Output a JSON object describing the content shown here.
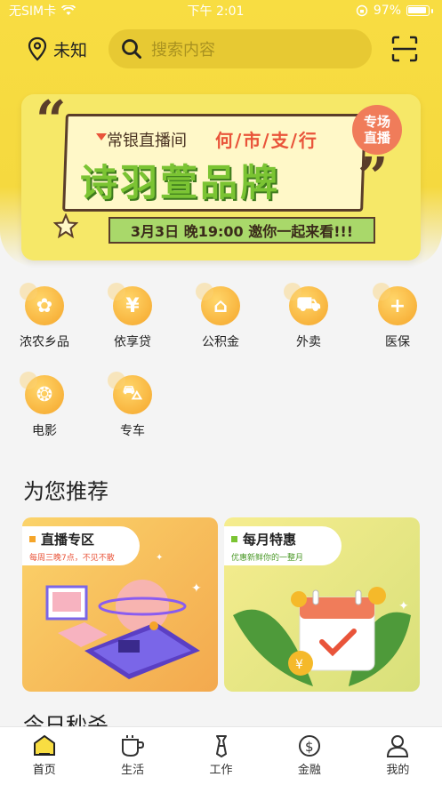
{
  "status_bar": {
    "carrier": "无SIM卡",
    "time": "下午 2:01",
    "battery": "97%"
  },
  "header": {
    "location": "未知",
    "search_placeholder": "搜索内容"
  },
  "banner": {
    "subtitle": "常银直播间",
    "tagline": "何/市/支/行",
    "title": "诗羽萱品牌",
    "bottom": "3月3日 晚19:00  邀你一起来看!!!",
    "badge": "专场直播"
  },
  "services": [
    {
      "label": "浓农乡品",
      "icon": "farm-icon"
    },
    {
      "label": "依享贷",
      "icon": "yen-icon"
    },
    {
      "label": "公积金",
      "icon": "house-icon"
    },
    {
      "label": "外卖",
      "icon": "scooter-icon"
    },
    {
      "label": "医保",
      "icon": "medical-cross-icon"
    },
    {
      "label": "电影",
      "icon": "film-reel-icon"
    },
    {
      "label": "专车",
      "icon": "car-icon"
    }
  ],
  "recommend": {
    "title": "为您推荐",
    "cards": [
      {
        "title": "直播专区",
        "subtitle": "每周三晚7点，不见不散"
      },
      {
        "title": "每月特惠",
        "subtitle": "优惠新鲜你的一整月"
      }
    ]
  },
  "next_section_title": "今日秒杀",
  "tabs": [
    {
      "label": "首页",
      "icon": "home-icon",
      "active": true
    },
    {
      "label": "生活",
      "icon": "cup-icon",
      "active": false
    },
    {
      "label": "工作",
      "icon": "tie-icon",
      "active": false
    },
    {
      "label": "金融",
      "icon": "dollar-coin-icon",
      "active": false
    },
    {
      "label": "我的",
      "icon": "person-icon",
      "active": false
    }
  ],
  "colors": {
    "brand_yellow": "#f8dd42",
    "icon_orange": "#f5a52a",
    "banner_green": "#7bc433",
    "accent_red": "#e9543a"
  }
}
